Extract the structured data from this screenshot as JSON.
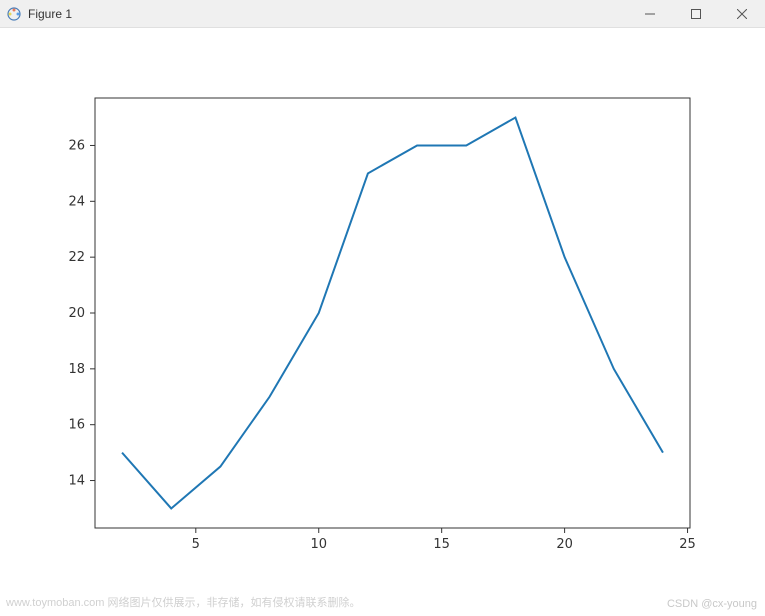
{
  "window": {
    "title": "Figure 1"
  },
  "watermarks": {
    "left": "www.toymoban.com 网络图片仅供展示，非存储，如有侵权请联系删除。",
    "right": "CSDN @cx-young"
  },
  "chart_data": {
    "type": "line",
    "x": [
      2,
      4,
      6,
      8,
      10,
      12,
      14,
      16,
      18,
      20,
      22,
      24
    ],
    "series": [
      {
        "name": "",
        "values": [
          15,
          13,
          14.5,
          17,
          20,
          25,
          26,
          26,
          27,
          22,
          18,
          15
        ],
        "color": "#1f77b4"
      }
    ],
    "title": "",
    "xlabel": "",
    "ylabel": "",
    "xlim": [
      0.9,
      25.1
    ],
    "ylim": [
      12.3,
      27.7
    ],
    "xticks": [
      5,
      10,
      15,
      20,
      25
    ],
    "yticks": [
      14,
      16,
      18,
      20,
      22,
      24,
      26
    ]
  }
}
